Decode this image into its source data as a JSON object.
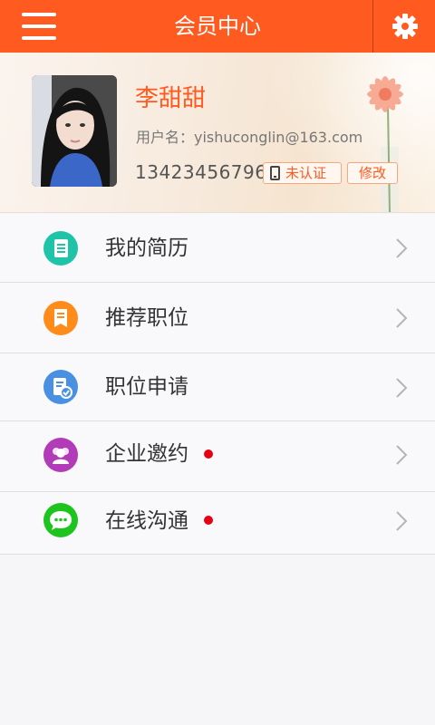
{
  "header": {
    "title": "会员中心",
    "menu_icon": "hamburger-menu-icon",
    "settings_icon": "gear-icon",
    "color": "#ff5a1f"
  },
  "profile": {
    "name": "李甜甜",
    "username": "用户名：yishuconglin@163.com",
    "phone": "13423456796",
    "verify_badge": "未认证",
    "edit_button": "修改",
    "accent": "#ff5a1f"
  },
  "menu": {
    "items": [
      {
        "label": "我的简历",
        "icon": "resume-icon",
        "color": "#1fc4a8",
        "has_dot": false
      },
      {
        "label": "推荐职位",
        "icon": "recommend-job-icon",
        "color": "#ff8c1a",
        "has_dot": false
      },
      {
        "label": "职位申请",
        "icon": "application-icon",
        "color": "#4a90e2",
        "has_dot": false
      },
      {
        "label": "企业邀约",
        "icon": "company-invite-icon",
        "color": "#b23bb7",
        "has_dot": true
      },
      {
        "label": "在线沟通",
        "icon": "chat-icon",
        "color": "#1ec41e",
        "has_dot": true
      }
    ],
    "dot_color": "#e60012"
  }
}
